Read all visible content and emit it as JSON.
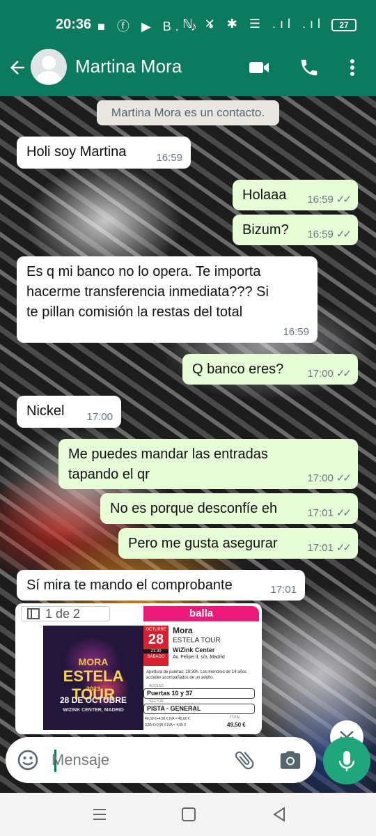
{
  "status_bar": {
    "time": "20:36",
    "left_icons": "■ ⓕ ▶ B. ♪ •",
    "right_icons": "ℕ ✕ ✱ ☰ .ıl .ıl",
    "battery": "27"
  },
  "header": {
    "contact_name": "Martina Mora"
  },
  "chat": {
    "system_message": "Martina Mora es un contacto.",
    "messages": [
      {
        "dir": "in",
        "lines": [
          "Holi soy Martina"
        ],
        "time": "16:59"
      },
      {
        "dir": "out",
        "lines": [
          "Holaaa"
        ],
        "time": "16:59"
      },
      {
        "dir": "out",
        "lines": [
          "Bizum?"
        ],
        "time": "16:59"
      },
      {
        "dir": "in",
        "lines": [
          "Es q mi banco no lo opera. Te importa",
          "hacerme transferencia inmediata??? Si",
          "te pillan comisión la restas del total"
        ],
        "time": "16:59"
      },
      {
        "dir": "out",
        "lines": [
          "Q banco eres?"
        ],
        "time": "17:00"
      },
      {
        "dir": "in",
        "lines": [
          "Nickel"
        ],
        "time": "17:00"
      },
      {
        "dir": "out",
        "lines": [
          "Me puedes mandar las entradas",
          "tapando el qr"
        ],
        "time": "17:00"
      },
      {
        "dir": "out",
        "lines": [
          "No es porque desconfíe eh"
        ],
        "time": "17:01"
      },
      {
        "dir": "out",
        "lines": [
          "Pero me gusta asegurar"
        ],
        "time": "17:01"
      },
      {
        "dir": "in",
        "lines": [
          "Sí mira te mando el comprobante"
        ],
        "time": "17:01"
      }
    ],
    "image_message": {
      "page_badge": "1 de 2",
      "ticket": {
        "brand": "balla",
        "month": "OCTUBRE",
        "day": "28",
        "hour": "21:30",
        "weekday": "SÁBADO",
        "artist": "Mora",
        "tour": "ESTELA TOUR",
        "venue": "WiZink Center",
        "address": "Av. Felipe II, s/n, Madrid",
        "doors_note_1": "Apertura de puertas: 19:30h. Los menores de 14 años",
        "doors_note_2": "acceder acompañados de un adulto.",
        "access_label": "ACCESO",
        "access_value": "Puertas 10 y 37",
        "sector_label": "SECTOR",
        "sector_value": "PISTA - GENERAL",
        "price_line_1": "40,50 €+4,50 € IVA = 45,00 €",
        "price_line_2": "3,55 €+0,95 € IVA = 4,50 €",
        "total_label": "TOTAL",
        "total_value": "49,50 €",
        "poster_title_1": "MORA",
        "poster_title_2": "ESTELA TOUR",
        "poster_year": "2023",
        "poster_date": "28 DE OCTUBRE",
        "poster_venue": "WIZINK CENTER, MADRID"
      }
    }
  },
  "input": {
    "placeholder": "Mensaje"
  },
  "colors": {
    "header_green": "#0b7a5e",
    "incoming_bubble": "#ffffff",
    "outgoing_bubble": "#e7fdd8",
    "mic_button": "#1fa67a",
    "ticket_brand": "#ec1b7a"
  }
}
